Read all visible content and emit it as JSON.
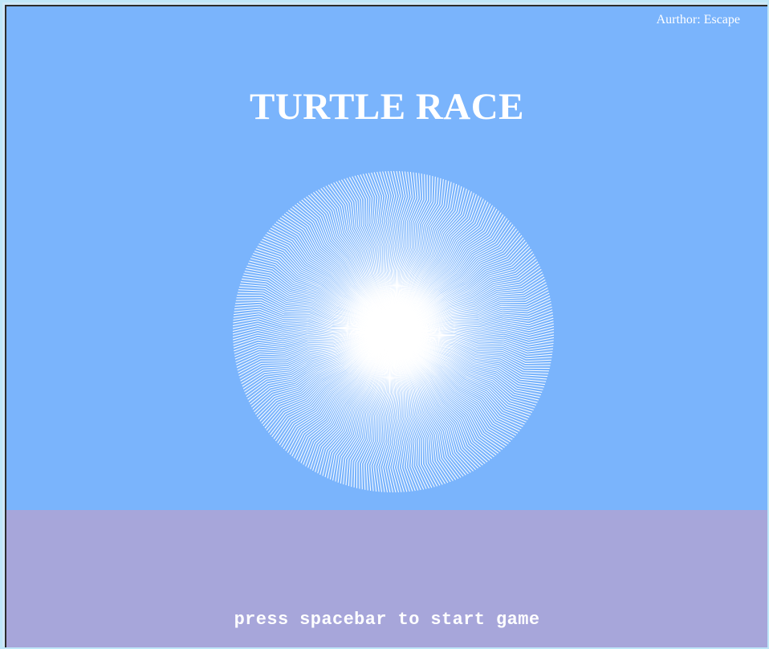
{
  "game": {
    "author": "Aurthor: Escape",
    "title": "TURTLE RACE",
    "prompt": "press spacebar to start game"
  },
  "colors": {
    "sky": "#7ab4fc",
    "ground": "#a7a6da",
    "text": "#ffffff",
    "pattern": "#ffffff"
  },
  "decoration": {
    "name": "spiral-rosette",
    "line_count": 360
  }
}
